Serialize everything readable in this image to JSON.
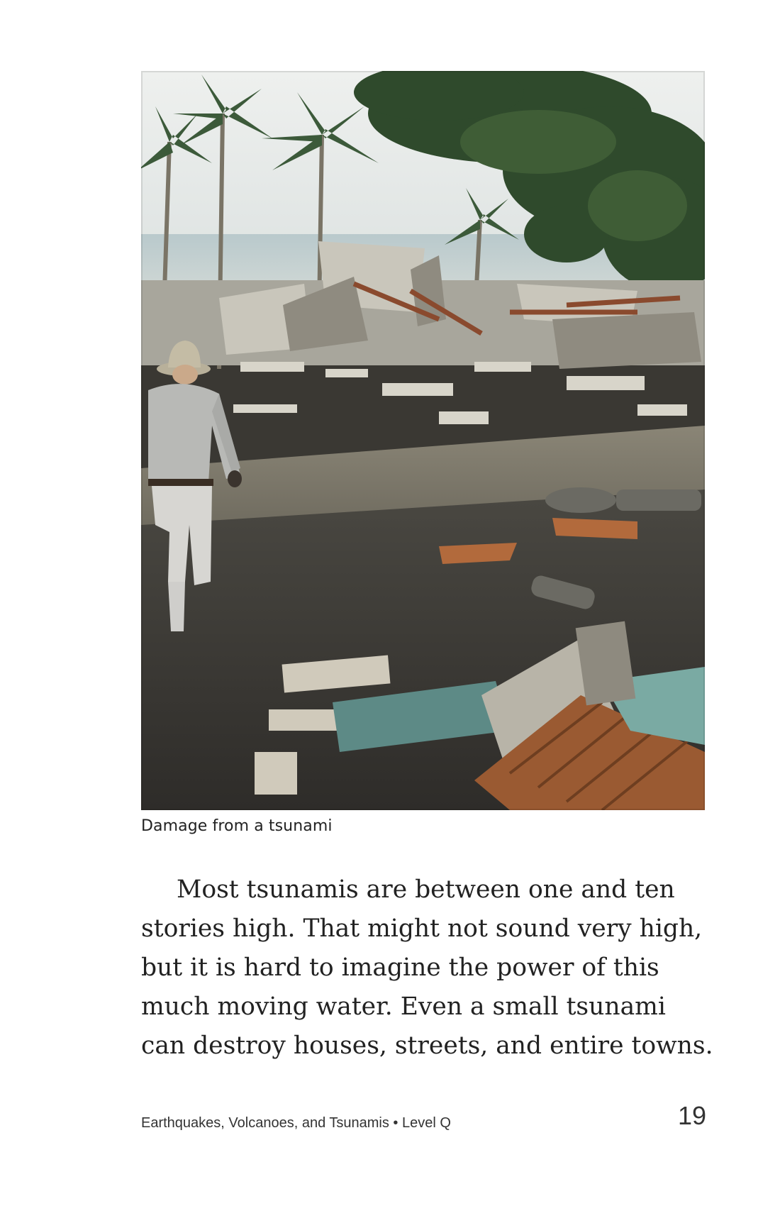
{
  "photo": {
    "description_icon": "photo-tsunami-damage"
  },
  "caption": "Damage from a tsunami",
  "body": {
    "lines": [
      "Most tsunamis are between one and ten",
      "stories high. That might not sound very high,",
      "but it is hard to imagine the power of this",
      "much moving water. Even a small tsunami",
      "can destroy houses, streets, and entire towns."
    ]
  },
  "footer": {
    "title": "Earthquakes, Volcanoes, and Tsunamis • Level Q",
    "page_number": "19"
  },
  "colors": {
    "text": "#222222",
    "background": "#ffffff"
  }
}
